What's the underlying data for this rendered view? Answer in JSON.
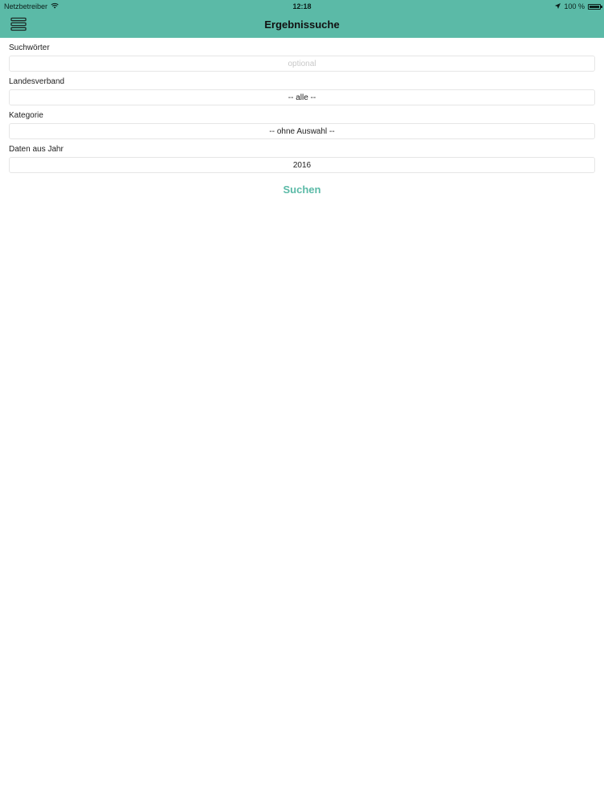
{
  "status_bar": {
    "carrier": "Netzbetreiber",
    "time": "12:18",
    "battery": "100 %"
  },
  "nav": {
    "title": "Ergebnissuche"
  },
  "form": {
    "keywords": {
      "label": "Suchwörter",
      "value": "",
      "placeholder": "optional"
    },
    "association": {
      "label": "Landesverband",
      "value": "-- alle --"
    },
    "category": {
      "label": "Kategorie",
      "value": "-- ohne Auswahl --"
    },
    "year": {
      "label": "Daten aus Jahr",
      "value": "2016"
    },
    "search_label": "Suchen"
  },
  "colors": {
    "accent": "#5bbaa7"
  },
  "icons": {
    "menu": "hamburger-stack-icon",
    "wifi": "wifi-icon",
    "location": "location-arrow-icon",
    "battery": "battery-icon"
  }
}
